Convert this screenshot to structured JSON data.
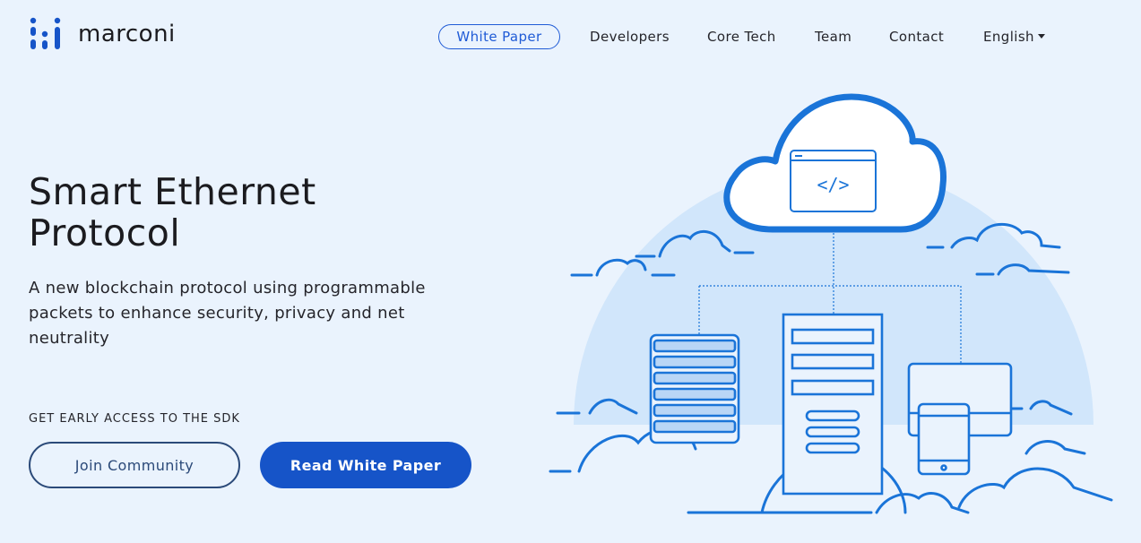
{
  "brand": {
    "name": "marconi",
    "accent": "#1654c8",
    "line_color": "#1a74d8",
    "background": "#eaf3fd"
  },
  "nav": {
    "items": [
      {
        "label": "White Paper",
        "active": true
      },
      {
        "label": "Developers"
      },
      {
        "label": "Core Tech"
      },
      {
        "label": "Team"
      },
      {
        "label": "Contact"
      }
    ],
    "language": "English",
    "language_icon": "caret-down-icon"
  },
  "hero": {
    "title_line1": "Smart Ethernet",
    "title_line2": "Protocol",
    "subtitle": "A new blockchain protocol using programmable packets to enhance security, privacy and net neutrality",
    "sdk_label": "GET EARLY ACCESS TO THE SDK",
    "join_button": "Join Community",
    "read_button": "Read White Paper"
  },
  "illustration": {
    "icons": [
      "cloud-icon",
      "code-window-icon",
      "server-icon",
      "server-tower-icon",
      "monitor-icon",
      "tablet-icon"
    ],
    "code_glyph": "</>"
  }
}
